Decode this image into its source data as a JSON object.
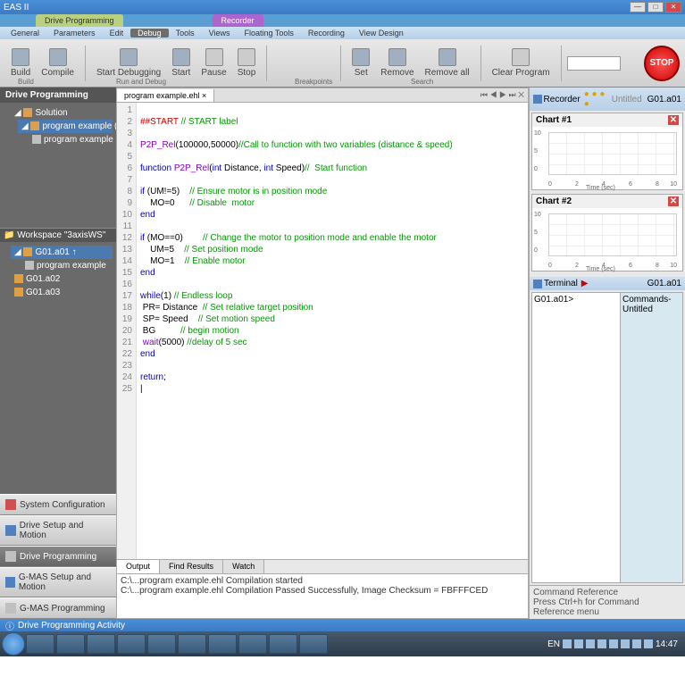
{
  "title_app": "EAS II",
  "top_tabs": [
    "Drive Programming",
    "Recorder"
  ],
  "menu": [
    "General",
    "Parameters",
    "Edit",
    "Debug",
    "Tools",
    "Views",
    "Floating Tools",
    "Recording",
    "View Design"
  ],
  "ribbon": {
    "build": "Build",
    "compile": "Compile",
    "startdbg": "Start\nDebugging",
    "start": "Start",
    "pause": "Pause",
    "stop": "Stop",
    "set": "Set",
    "remove": "Remove",
    "removeall": "Remove all",
    "clear": "Clear\nProgram",
    "g1": "Build",
    "g2": "Run and Debug",
    "g3": "Breakpoints",
    "g4": "Search",
    "stopbtn": "STOP"
  },
  "left": {
    "hdr": "Drive Programming",
    "sol": "Solution",
    "prj": "program example (Debug) <",
    "file": "program example",
    "ws": "Workspace \"3axisWS\"",
    "n1": "G01.a01",
    "n2": "program example",
    "n3": "G01.a02",
    "n4": "G01.a03"
  },
  "nav": [
    "System Configuration",
    "Drive Setup and Motion",
    "Drive Programming",
    "G-MAS Setup and Motion",
    "G-MAS Programming"
  ],
  "editor_tab": "program example.ehl ×",
  "lines": [
    "1",
    "2",
    "3",
    "4",
    "5",
    "6",
    "7",
    "8",
    "9",
    "10",
    "11",
    "12",
    "13",
    "14",
    "15",
    "16",
    "17",
    "18",
    "19",
    "20",
    "21",
    "22",
    "23",
    "24",
    "25"
  ],
  "bottom_tabs": [
    "Output",
    "Find Results",
    "Watch"
  ],
  "output": [
    "C:\\...program example.ehl Compilation started",
    "C:\\...program example.ehl Compilation Passed Successfully, Image Checksum =  FBFFFCED"
  ],
  "recorder": {
    "hdr": "Recorder",
    "sub": "Untitled",
    "dev": "G01.a01"
  },
  "charts": [
    {
      "title": "Chart #1",
      "xaxis": "Time (sec)"
    },
    {
      "title": "Chart #2",
      "xaxis": "Time (sec)"
    }
  ],
  "chart_data": [
    {
      "type": "line",
      "title": "Chart #1",
      "xlabel": "Time (sec)",
      "ylabel": "",
      "x": [
        0,
        2,
        4,
        6,
        8,
        10
      ],
      "ylim": [
        0,
        10
      ],
      "series": []
    },
    {
      "type": "line",
      "title": "Chart #2",
      "xlabel": "Time (sec)",
      "ylabel": "",
      "x": [
        0,
        2,
        4,
        6,
        8,
        10
      ],
      "ylim": [
        0,
        10
      ],
      "series": []
    }
  ],
  "terminal": {
    "hdr": "Terminal",
    "dev": "G01.a01",
    "prompt": "G01.a01>",
    "cmds": "Commands- Untitled"
  },
  "cmdref": {
    "l1": "Command Reference",
    "l2": "Press Ctrl+h for Command Reference menu"
  },
  "status": "Drive Programming Activity",
  "tray": {
    "lang": "EN",
    "time": "14:47"
  }
}
